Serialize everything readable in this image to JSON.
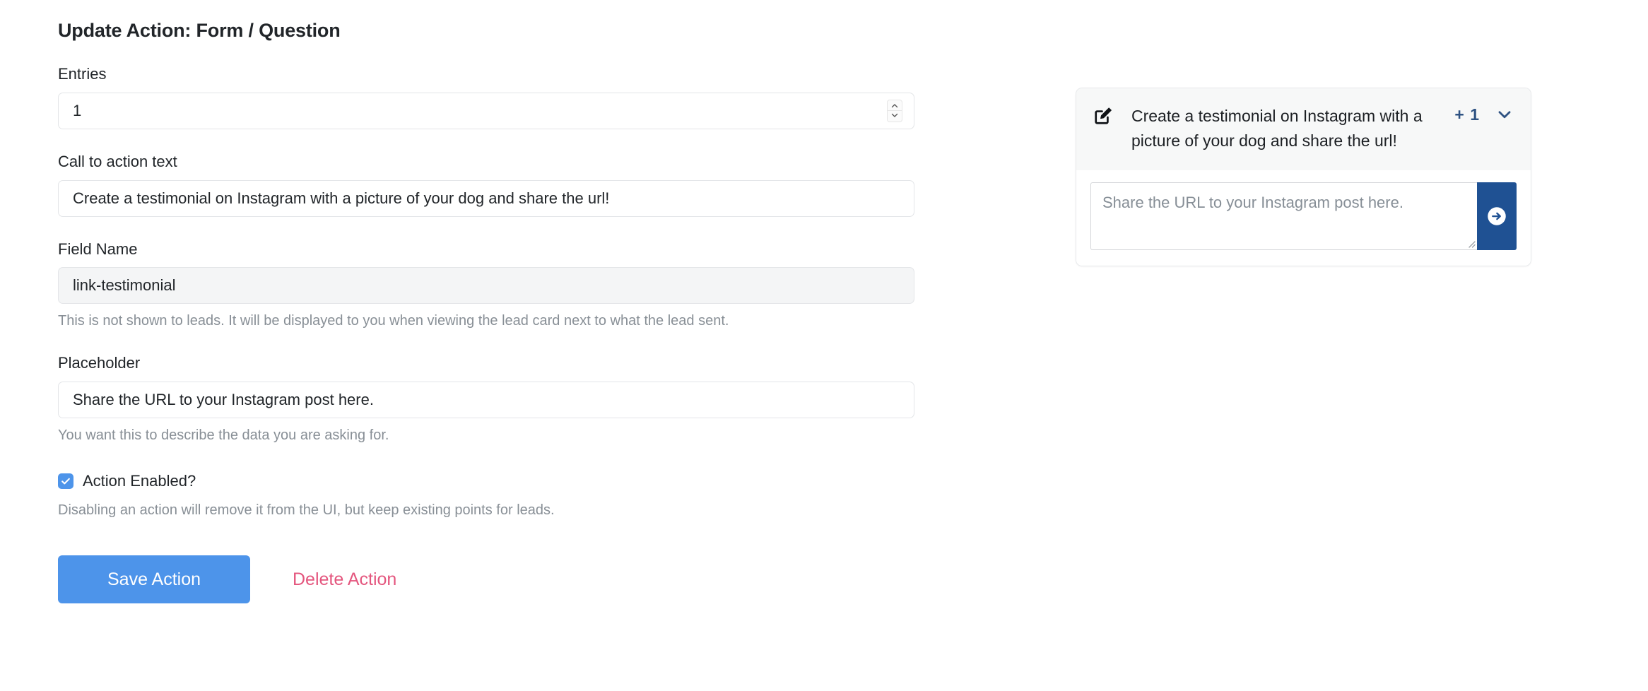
{
  "page": {
    "title": "Update Action: Form / Question"
  },
  "form": {
    "entries": {
      "label": "Entries",
      "value": "1",
      "placeholder": ""
    },
    "cta": {
      "label": "Call to action text",
      "value": "Create a testimonial on Instagram with a picture of your dog and share the url!",
      "placeholder": ""
    },
    "field_name": {
      "label": "Field Name",
      "value": "link-testimonial",
      "placeholder": "",
      "help": "This is not shown to leads. It will be displayed to you when viewing the lead card next to what the lead sent."
    },
    "placeholder_field": {
      "label": "Placeholder",
      "value": "Share the URL to your Instagram post here.",
      "placeholder": "",
      "help": "You want this to describe the data you are asking for."
    },
    "action_enabled": {
      "label": "Action Enabled?",
      "checked": true,
      "help": "Disabling an action will remove it from the UI, but keep existing points for leads."
    },
    "buttons": {
      "save": "Save Action",
      "delete": "Delete Action"
    }
  },
  "preview": {
    "edit_icon": "edit-square-icon",
    "title": "Create a testimonial on Instagram with a picture of your dog and share the url!",
    "points_badge": "+ 1",
    "chevron_icon": "chevron-down-icon",
    "answer_placeholder": "Share the URL to your Instagram post here.",
    "send_icon": "arrow-right-circle-icon"
  },
  "colors": {
    "primary_blue": "#4d94ea",
    "delete_pink": "#e4567e",
    "navy": "#1f5193",
    "badge_navy": "#2f5383",
    "help_grey": "#888f96",
    "card_header_bg": "#f7f8f8",
    "readonly_bg": "#f4f5f6"
  }
}
